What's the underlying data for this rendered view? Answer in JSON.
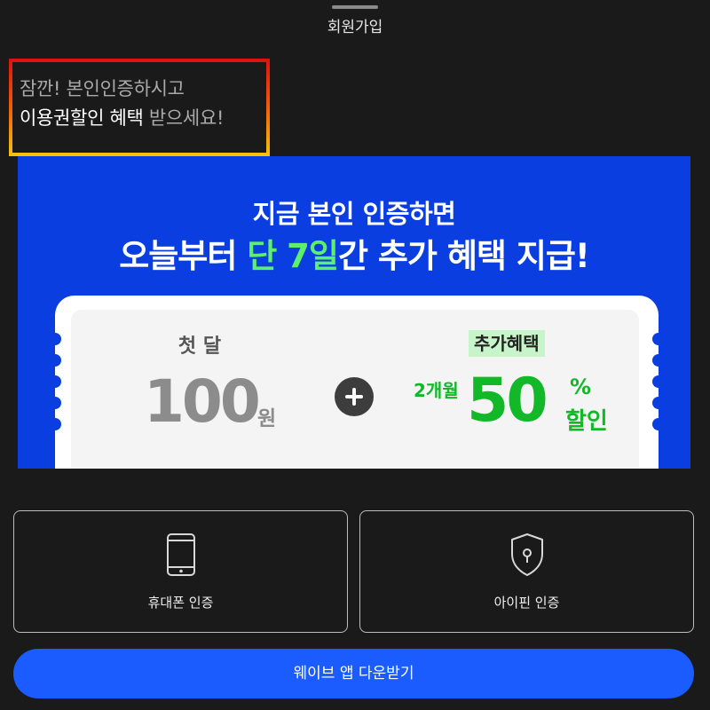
{
  "sheet": {
    "title": "회원가입"
  },
  "headline": {
    "line1": "잠깐! 본인인증하시고",
    "line2_highlight": "이용권할인 혜택",
    "line2_rest": " 받으세요!"
  },
  "banner": {
    "line1": "지금 본인 인증하면",
    "line2_part1": "오늘부터 ",
    "line2_highlight": "단 7일",
    "line2_part2": "간 추가 혜택 지급!",
    "first_month_label": "첫 달",
    "price_value": "100",
    "price_unit": "원",
    "extra_benefit_label": "추가혜택",
    "months_label": "2개월",
    "discount_value": "50",
    "percent_sign": "%",
    "discount_word": "할인"
  },
  "auth_options": [
    {
      "label": "휴대폰 인증",
      "icon": "smartphone-icon"
    },
    {
      "label": "아이핀 인증",
      "icon": "shield-keyhole-icon"
    }
  ],
  "download_button": {
    "label": "웨이브 앱 다운받기"
  },
  "colors": {
    "background": "#1a1a1a",
    "banner_blue": "#0a3ee0",
    "accent_green": "#13b829",
    "button_blue": "#1a5cff"
  }
}
